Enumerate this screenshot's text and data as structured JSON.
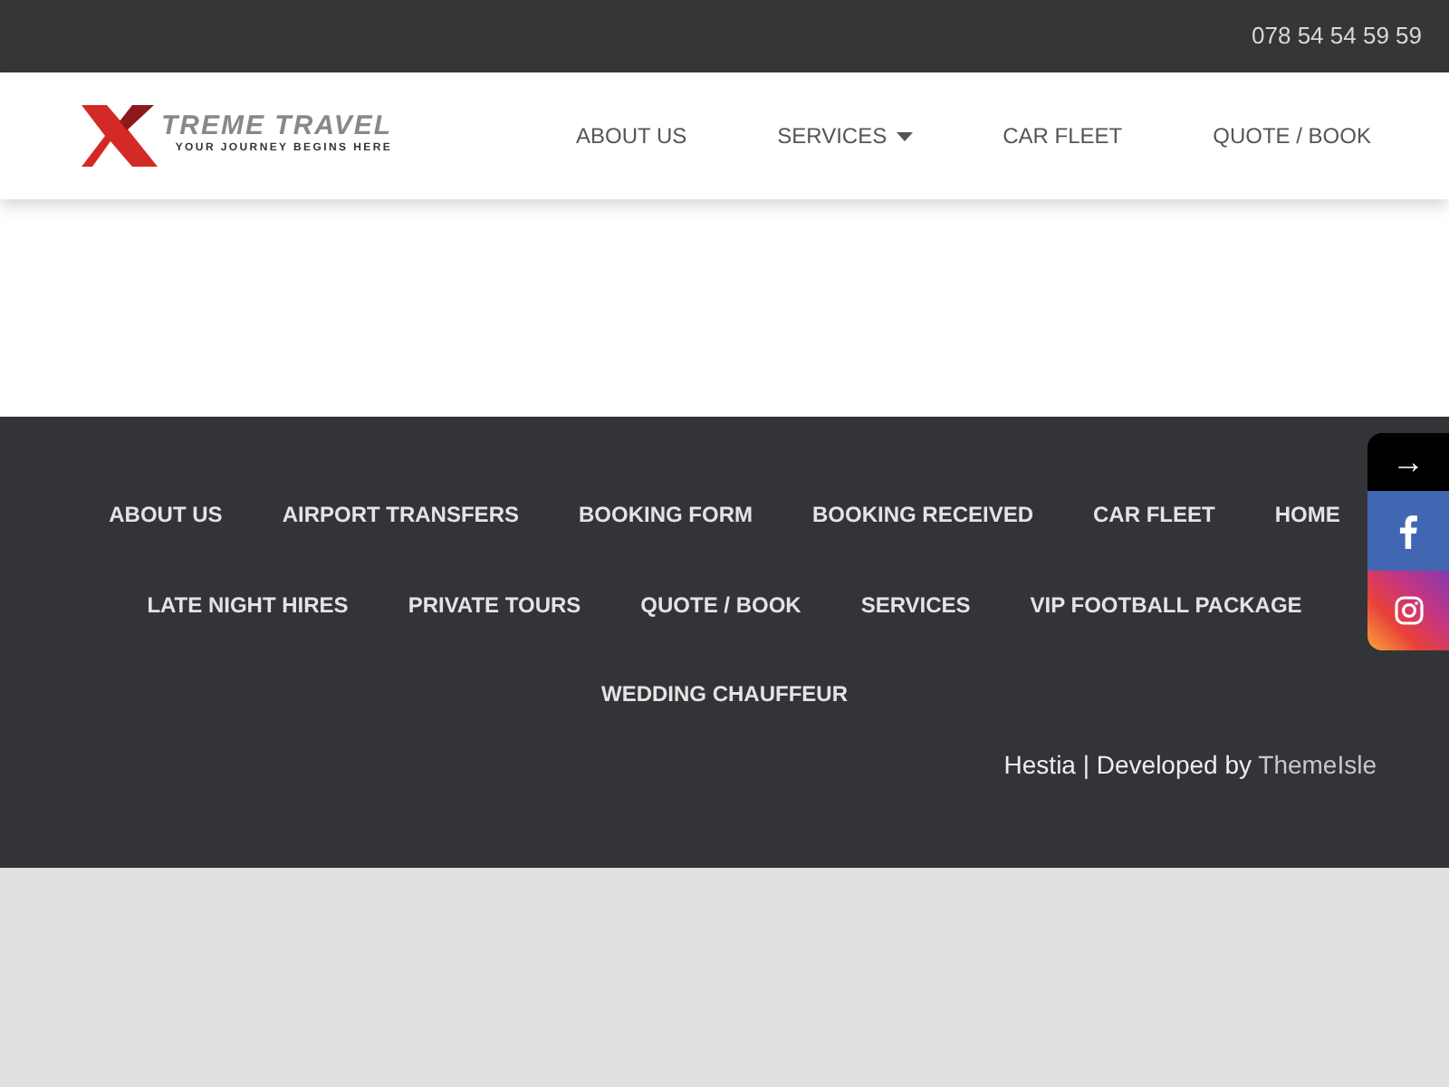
{
  "top_bar": {
    "phone": "078 54 54 59 59"
  },
  "logo": {
    "title": "TREME TRAVEL",
    "tagline": "YOUR JOURNEY BEGINS HERE"
  },
  "nav": [
    {
      "label": "ABOUT US",
      "has_dropdown": false
    },
    {
      "label": "SERVICES",
      "has_dropdown": true
    },
    {
      "label": "CAR FLEET",
      "has_dropdown": false
    },
    {
      "label": "QUOTE / BOOK",
      "has_dropdown": false
    }
  ],
  "footer_menu": [
    [
      "ABOUT US",
      "AIRPORT TRANSFERS",
      "BOOKING FORM",
      "BOOKING RECEIVED",
      "CAR FLEET",
      "HOME"
    ],
    [
      "LATE NIGHT HIRES",
      "PRIVATE TOURS",
      "QUOTE / BOOK",
      "SERVICES",
      "VIP FOOTBALL PACKAGE"
    ],
    [
      "WEDDING CHAUFFEUR"
    ]
  ],
  "credit": {
    "text": "Hestia | Developed by",
    "link": "ThemeIsle"
  },
  "social": [
    {
      "kind": "toggle",
      "label": "→"
    },
    {
      "kind": "facebook"
    },
    {
      "kind": "instagram"
    }
  ]
}
